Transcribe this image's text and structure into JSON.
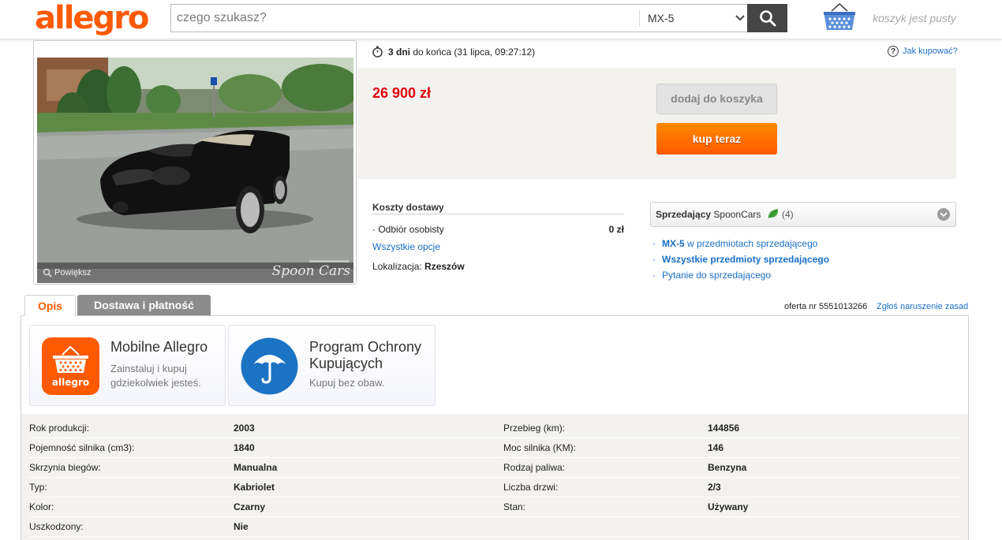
{
  "header": {
    "logo": "allegro",
    "search_placeholder": "czego szukasz?",
    "category": "MX-5",
    "cart_text": "koszyk jest pusty"
  },
  "gallery": {
    "zoom_label": "Powiększ",
    "watermark": "Spoon Cars"
  },
  "offer": {
    "time_bold": "3 dni",
    "time_rest": "do końca (31 lipca, 09:27:12)",
    "how_to_buy": "Jak kupować?",
    "price": "26 900 zł",
    "add_to_cart": "dodaj do koszyka",
    "buy_now": "kup teraz"
  },
  "shipping": {
    "title": "Koszty dostawy",
    "option_label": "Odbiór osobisty",
    "option_value": "0 zł",
    "all_options": "Wszystkie opcje",
    "location_label": "Lokalizacja:",
    "location_value": "Rzeszów"
  },
  "seller": {
    "label": "Sprzedający",
    "name": "SpoonCars",
    "rating": "(4)",
    "link1_bold": "MX-5",
    "link1_rest": "w przedmiotach sprzedającego",
    "link2": "Wszystkie przedmioty sprzedającego",
    "link3": "Pytanie do sprzedającego"
  },
  "tabs": {
    "description": "Opis",
    "delivery": "Dostawa i płatność",
    "offer_no": "oferta nr 5551013266",
    "report": "Zgłoś naruszenie zasad"
  },
  "promos": [
    {
      "title_line1": "Mobilne Allegro",
      "title_line2": "",
      "sub_line1": "Zainstaluj i kupuj",
      "sub_line2": "gdziekolwiek jesteś.",
      "icon": "allegro-app-icon",
      "icon_text": "allegro"
    },
    {
      "title_line1": "Program Ochrony",
      "title_line2": "Kupujących",
      "sub_line1": "Kupuj bez obaw.",
      "sub_line2": "",
      "icon": "umbrella-icon"
    }
  ],
  "params": [
    {
      "l1": "Rok produkcji:",
      "v1": "2003",
      "l2": "Przebieg (km):",
      "v2": "144856"
    },
    {
      "l1": "Pojemność silnika (cm3):",
      "v1": "1840",
      "l2": "Moc silnika (KM):",
      "v2": "146"
    },
    {
      "l1": "Skrzynia biegów:",
      "v1": "Manualna",
      "l2": "Rodzaj paliwa:",
      "v2": "Benzyna"
    },
    {
      "l1": "Typ:",
      "v1": "Kabriolet",
      "l2": "Liczba drzwi:",
      "v2": "2/3"
    },
    {
      "l1": "Kolor:",
      "v1": "Czarny",
      "l2": "Stan:",
      "v2": "Używany"
    },
    {
      "l1": "Uszkodzony:",
      "v1": "Nie",
      "l2": "",
      "v2": ""
    }
  ],
  "colors": {
    "brand_orange": "#ff5a00",
    "price_red": "#e3000f",
    "link_blue": "#1a6fc9",
    "protection_blue": "#1b73c4"
  }
}
